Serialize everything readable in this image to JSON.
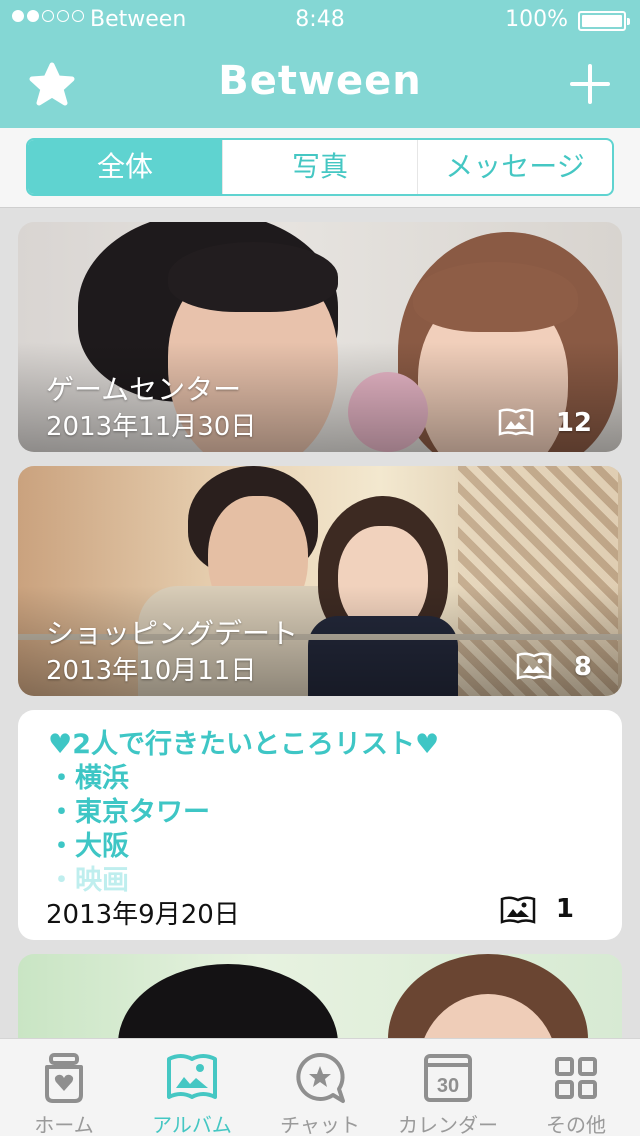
{
  "status_bar": {
    "carrier": "Between",
    "time": "8:48",
    "battery": "100%",
    "signal_bars_filled": 2,
    "signal_bars_total": 5
  },
  "nav": {
    "title": "Between",
    "left_icon": "star-icon",
    "right_icon": "plus-icon"
  },
  "segments": [
    {
      "label": "全体",
      "active": true
    },
    {
      "label": "写真",
      "active": false
    },
    {
      "label": "メッセージ",
      "active": false
    }
  ],
  "albums": [
    {
      "title": "ゲームセンター",
      "date": "2013年11月30日",
      "count": "12",
      "icon": "photo-book-icon"
    },
    {
      "title": "ショッピングデート",
      "date": "2013年10月11日",
      "count": "8",
      "icon": "photo-book-icon"
    }
  ],
  "note": {
    "lines": [
      "♥2人で行きたいところリスト♥",
      "・横浜",
      "・東京タワー",
      "・大阪",
      "・映画"
    ],
    "date": "2013年9月20日",
    "count": "1",
    "icon": "photo-book-icon"
  },
  "tabs": [
    {
      "label": "ホーム",
      "icon": "home-jar-icon",
      "active": false
    },
    {
      "label": "アルバム",
      "icon": "album-icon",
      "active": true
    },
    {
      "label": "チャット",
      "icon": "chat-icon",
      "active": false
    },
    {
      "label": "カレンダー",
      "icon": "calendar-icon",
      "icon_text": "30",
      "active": false
    },
    {
      "label": "その他",
      "icon": "grid-icon",
      "active": false
    }
  ],
  "colors": {
    "accent": "#5fd3d0",
    "header": "#84d7d4",
    "note_text": "#3ec6c5"
  }
}
